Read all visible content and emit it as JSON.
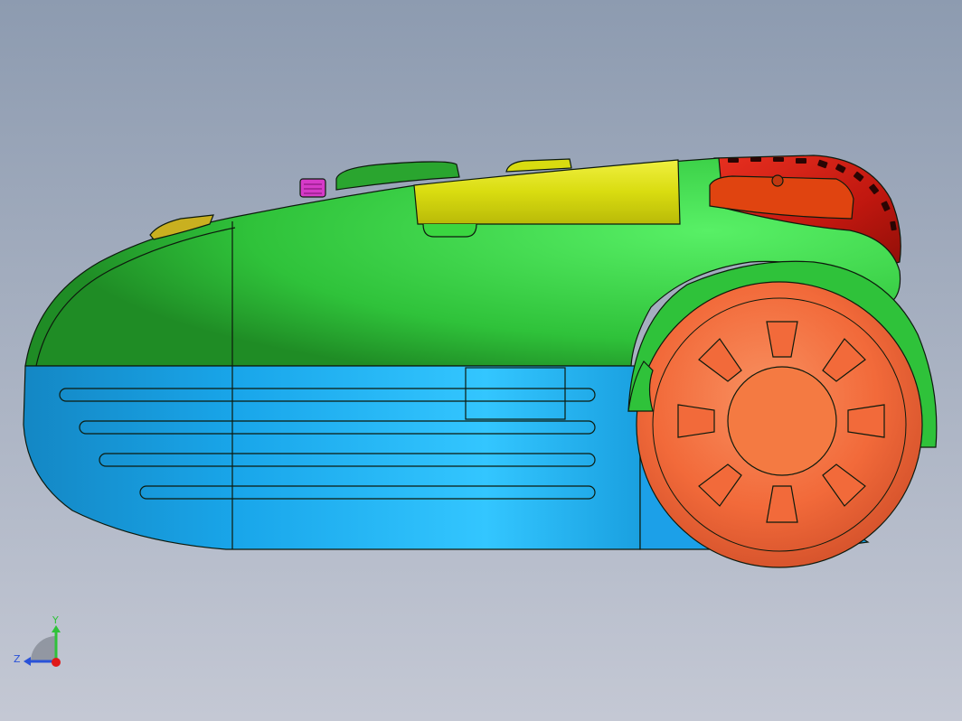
{
  "viewport": {
    "background_top": "#8d9bb0",
    "background_bottom": "#c4c8d4"
  },
  "model": {
    "colors": {
      "upper_shell": "#2fc23a",
      "upper_shell_highlight": "#58f066",
      "lower_shell": "#19a6ea",
      "lower_shell_highlight": "#33c6ff",
      "wheel": "#f26a3a",
      "wheel_hub": "#f47a42",
      "top_cover": "#d9dc10",
      "rear_vent": "#c0170f",
      "rear_button": "#e04410",
      "front_button": "#c9b020",
      "top_knob": "#2aa52f",
      "pink_tab": "#d63ac8",
      "edge": "#0d1a0d"
    }
  },
  "triad": {
    "y_label": "Y",
    "z_label": "Z",
    "y_color": "#2fc23a",
    "z_color": "#2a52d8",
    "origin_color": "#e01818"
  }
}
